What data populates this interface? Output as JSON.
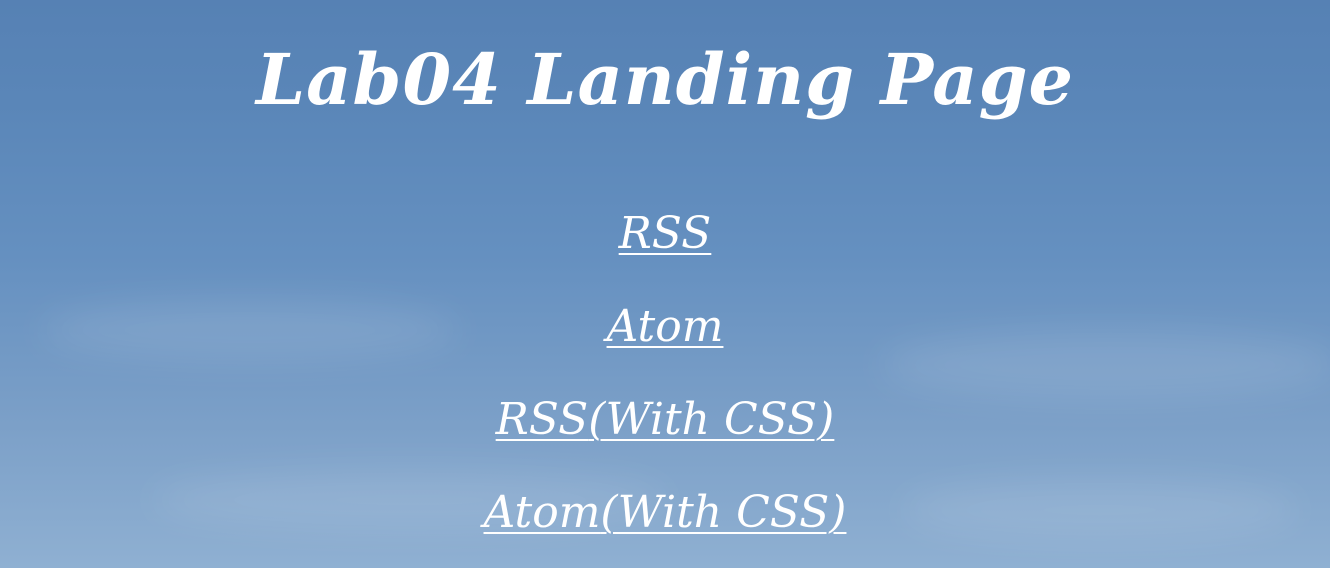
{
  "page": {
    "title": "Lab04 Landing Page"
  },
  "links": [
    {
      "label": "RSS",
      "suffix": ""
    },
    {
      "label": "Atom",
      "suffix": ""
    },
    {
      "label": "RSS",
      "suffix": "(With CSS)"
    },
    {
      "label": "Atom",
      "suffix": "(With CSS)"
    }
  ],
  "colors": {
    "text": "#ffffff",
    "sky_top": "#5681b4",
    "sky_bottom": "#8fb0d2"
  }
}
